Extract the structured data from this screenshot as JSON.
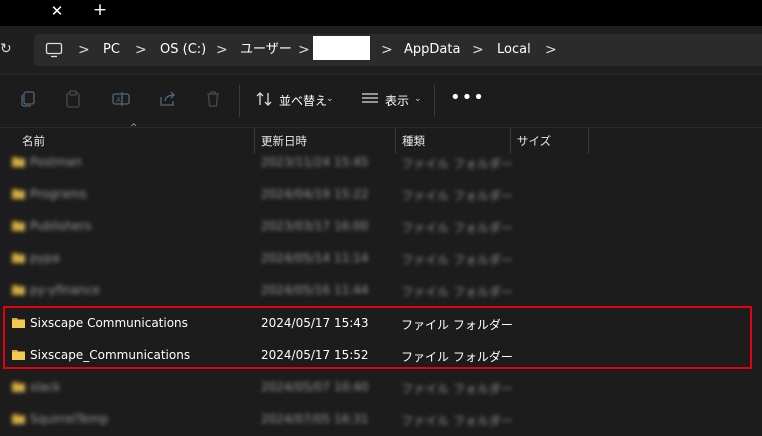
{
  "titlebar": {
    "close_glyph": "✕",
    "new_tab_glyph": "+"
  },
  "address": {
    "refresh_glyph": "↻",
    "crumbs": [
      "PC",
      "OS (C:)",
      "ユーザー",
      "",
      "AppData",
      "Local"
    ],
    "separator": ">"
  },
  "commandbar": {
    "sort_label": "並べ替え",
    "view_label": "表示",
    "more_glyph": "•••",
    "icons": [
      "copy-icon",
      "paste-icon",
      "rename-icon",
      "share-icon",
      "delete-icon"
    ]
  },
  "columns": {
    "name": "名前",
    "modified": "更新日時",
    "type": "種類",
    "size": "サイズ"
  },
  "rows": [
    {
      "name": "Postman",
      "modified": "2023/11/24 15:45",
      "type": "ファイル フォルダー",
      "blurred": true
    },
    {
      "name": "Programs",
      "modified": "2024/04/19 15:22",
      "type": "ファイル フォルダー",
      "blurred": true
    },
    {
      "name": "Publishers",
      "modified": "2023/03/17 16:00",
      "type": "ファイル フォルダー",
      "blurred": true
    },
    {
      "name": "pypa",
      "modified": "2024/05/14 11:14",
      "type": "ファイル フォルダー",
      "blurred": true
    },
    {
      "name": "py-yfinance",
      "modified": "2024/05/16 11:44",
      "type": "ファイル フォルダー",
      "blurred": true
    },
    {
      "name": "Sixscape Communications",
      "modified": "2024/05/17 15:43",
      "type": "ファイル フォルダー",
      "blurred": false
    },
    {
      "name": "Sixscape_Communications",
      "modified": "2024/05/17 15:52",
      "type": "ファイル フォルダー",
      "blurred": false
    },
    {
      "name": "slack",
      "modified": "2024/05/07 10:40",
      "type": "ファイル フォルダー",
      "blurred": true
    },
    {
      "name": "SquirrelTemp",
      "modified": "2024/07/05 16:31",
      "type": "ファイル フォルダー",
      "blurred": true
    }
  ],
  "colors": {
    "folder": "#f2c94c",
    "folder_dark": "#d9a93a",
    "highlight": "#e3000f",
    "background": "#1c1c1c"
  }
}
